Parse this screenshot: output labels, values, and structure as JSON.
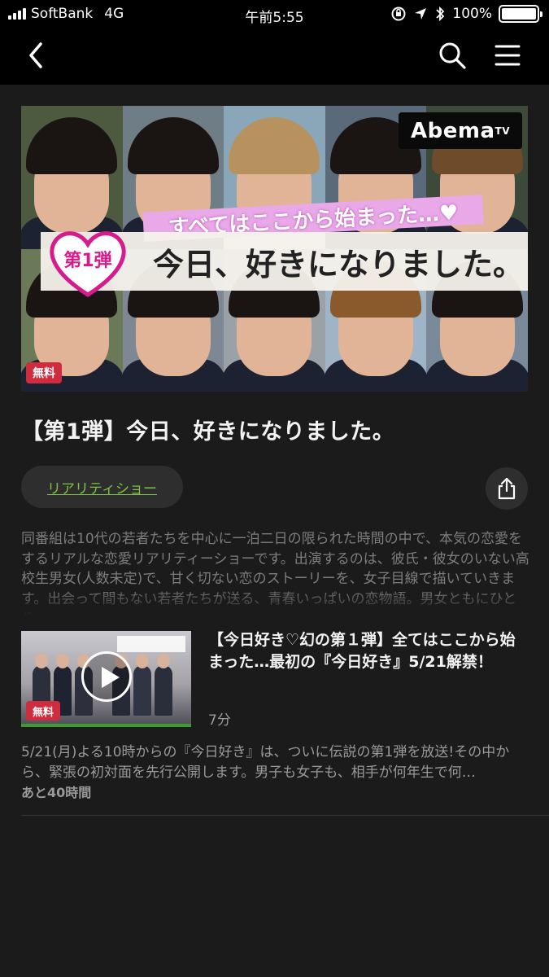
{
  "status_bar": {
    "carrier": "SoftBank",
    "network": "4G",
    "time": "午前5:55",
    "battery": "100%"
  },
  "nav": {
    "icons": [
      "back-icon",
      "search-icon",
      "menu-icon"
    ]
  },
  "hero": {
    "logo_text": "Abema",
    "logo_sup": "TV",
    "banner_text": "すべてはここから始まった…♥",
    "heart_text": "第1弾",
    "title_text": "今日、好きになりました。",
    "badge": "無料"
  },
  "program": {
    "title": "【第1弾】今日、好きになりました。",
    "genre": "リアリティショー",
    "description": "同番組は10代の若者たちを中心に一泊二日の限られた時間の中で、本気の恋愛をするリアルな恋愛リアリティーショーです。出演するのは、彼氏・彼女のいない高校生男女(人数未定)で、甘く切ない恋のストーリーを、女子目線で描いていきます。出会って間もない若者たちが送る、青春いっぱいの恋物語。男女ともにひとり"
  },
  "episode": {
    "badge": "無料",
    "title": "【今日好き♡幻の第１弾】全てはここから始まった…最初の『今日好き』5/21解禁！",
    "duration": "7分",
    "description": "5/21(月)よる10時からの『今日好き』は、ついに伝説の第1弾を放送!その中から、緊張の初対面を先行公開します。男子も女子も、相手が何年生で何…",
    "remaining": "あと40時間",
    "progress": 1.0
  },
  "colors": {
    "background": "#1b1b1b",
    "topbar": "#000000",
    "accent_green": "#7dc242",
    "badge_red": "#cf2d3f"
  }
}
